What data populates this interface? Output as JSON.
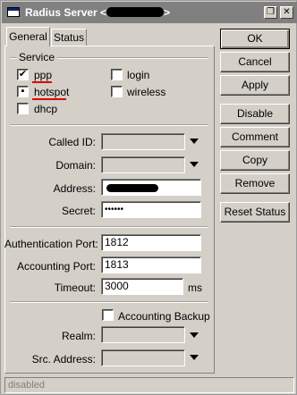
{
  "window": {
    "title_prefix": "Radius Server <",
    "title_suffix": ">",
    "title_buttons": {
      "restore": "❐",
      "close": "✕"
    }
  },
  "tabs": [
    {
      "label": "General",
      "active": true
    },
    {
      "label": "Status",
      "active": false
    }
  ],
  "service": {
    "group_label": "Service",
    "items": [
      {
        "label": "ppp",
        "checked": true,
        "mark": "✔"
      },
      {
        "label": "hotspot",
        "checked": true,
        "mark": "▪"
      },
      {
        "label": "dhcp",
        "checked": false,
        "mark": ""
      },
      {
        "label": "login",
        "checked": false,
        "mark": ""
      },
      {
        "label": "wireless",
        "checked": false,
        "mark": ""
      }
    ]
  },
  "fields": {
    "called_id": {
      "label": "Called ID:",
      "value": ""
    },
    "domain": {
      "label": "Domain:",
      "value": ""
    },
    "address": {
      "label": "Address:",
      "value": ""
    },
    "secret": {
      "label": "Secret:",
      "value": "••••••"
    },
    "auth_port": {
      "label": "Authentication Port:",
      "value": "1812"
    },
    "acct_port": {
      "label": "Accounting Port:",
      "value": "1813"
    },
    "timeout": {
      "label": "Timeout:",
      "value": "3000",
      "unit": "ms"
    },
    "accounting_backup": {
      "label": "Accounting Backup",
      "checked": false
    },
    "realm": {
      "label": "Realm:",
      "value": ""
    },
    "src_address": {
      "label": "Src. Address:",
      "value": ""
    }
  },
  "buttons": {
    "ok": "OK",
    "cancel": "Cancel",
    "apply": "Apply",
    "disable": "Disable",
    "comment": "Comment",
    "copy": "Copy",
    "remove": "Remove",
    "reset_status": "Reset Status"
  },
  "status_bar": {
    "text": "disabled"
  },
  "colors": {
    "accent_underline": "#e00000",
    "redaction": "#000000"
  }
}
